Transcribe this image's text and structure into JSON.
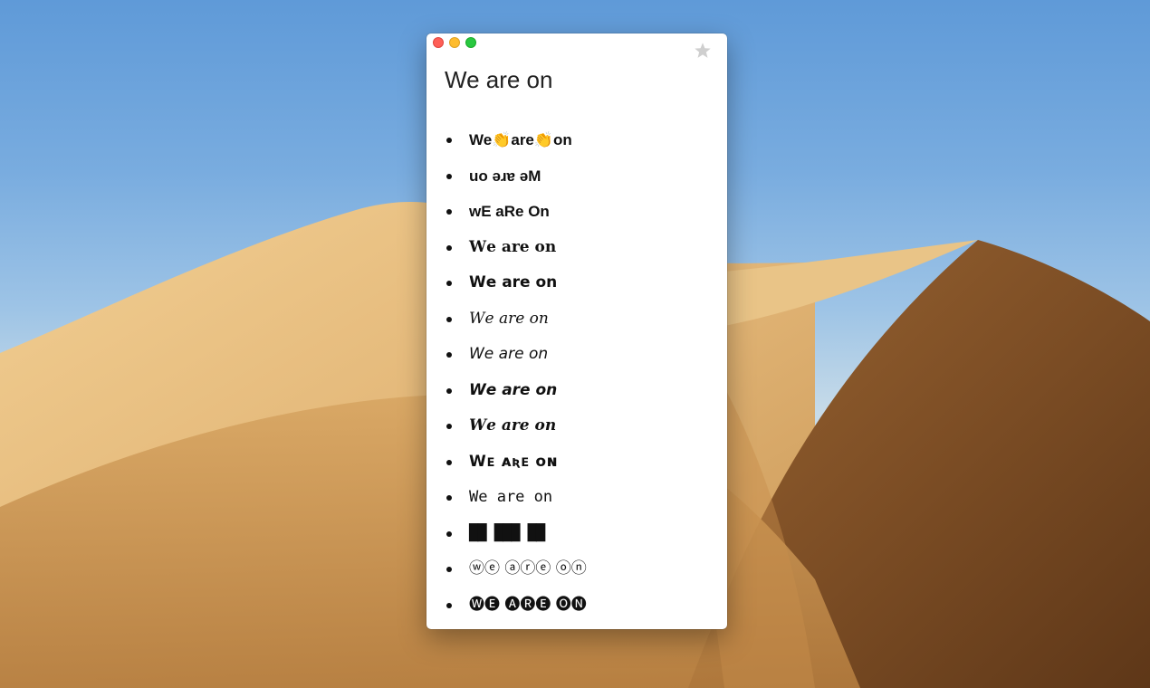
{
  "window": {
    "title": "We are on"
  },
  "icons": {
    "close": "close-icon",
    "minimize": "minimize-icon",
    "maximize": "maximize-icon",
    "favorite": "star-icon"
  },
  "colors": {
    "close": "#fe5f57",
    "minimize": "#febc2e",
    "maximize": "#28c840",
    "star": "#c8c8c8"
  },
  "variants": [
    "We👏are👏on",
    "uo ǝɹɐ ǝM",
    "wE aRe On",
    "𝐖𝐞 𝐚𝐫𝐞 𝐨𝐧",
    "𝗪𝗲 𝗮𝗿𝗲 𝗼𝗻",
    "𝑊𝑒 𝑎𝑟𝑒 𝑜𝑛",
    "𝘞𝘦 𝘢𝘳𝘦 𝘰𝘯",
    "𝙒𝙚 𝙖𝙧𝙚 𝙤𝙣",
    "𝑾𝒆 𝒂𝒓𝒆 𝒐𝒏",
    "Wᴇ ᴀʀᴇ ᴏɴ",
    "𝚆𝚎 𝚊𝚛𝚎 𝚘𝚗",
    "██ ███ ██",
    "ⓦⓔ ⓐⓡⓔ ⓞⓝ",
    "🅦🅔 🅐🅡🅔 🅞🅝"
  ]
}
